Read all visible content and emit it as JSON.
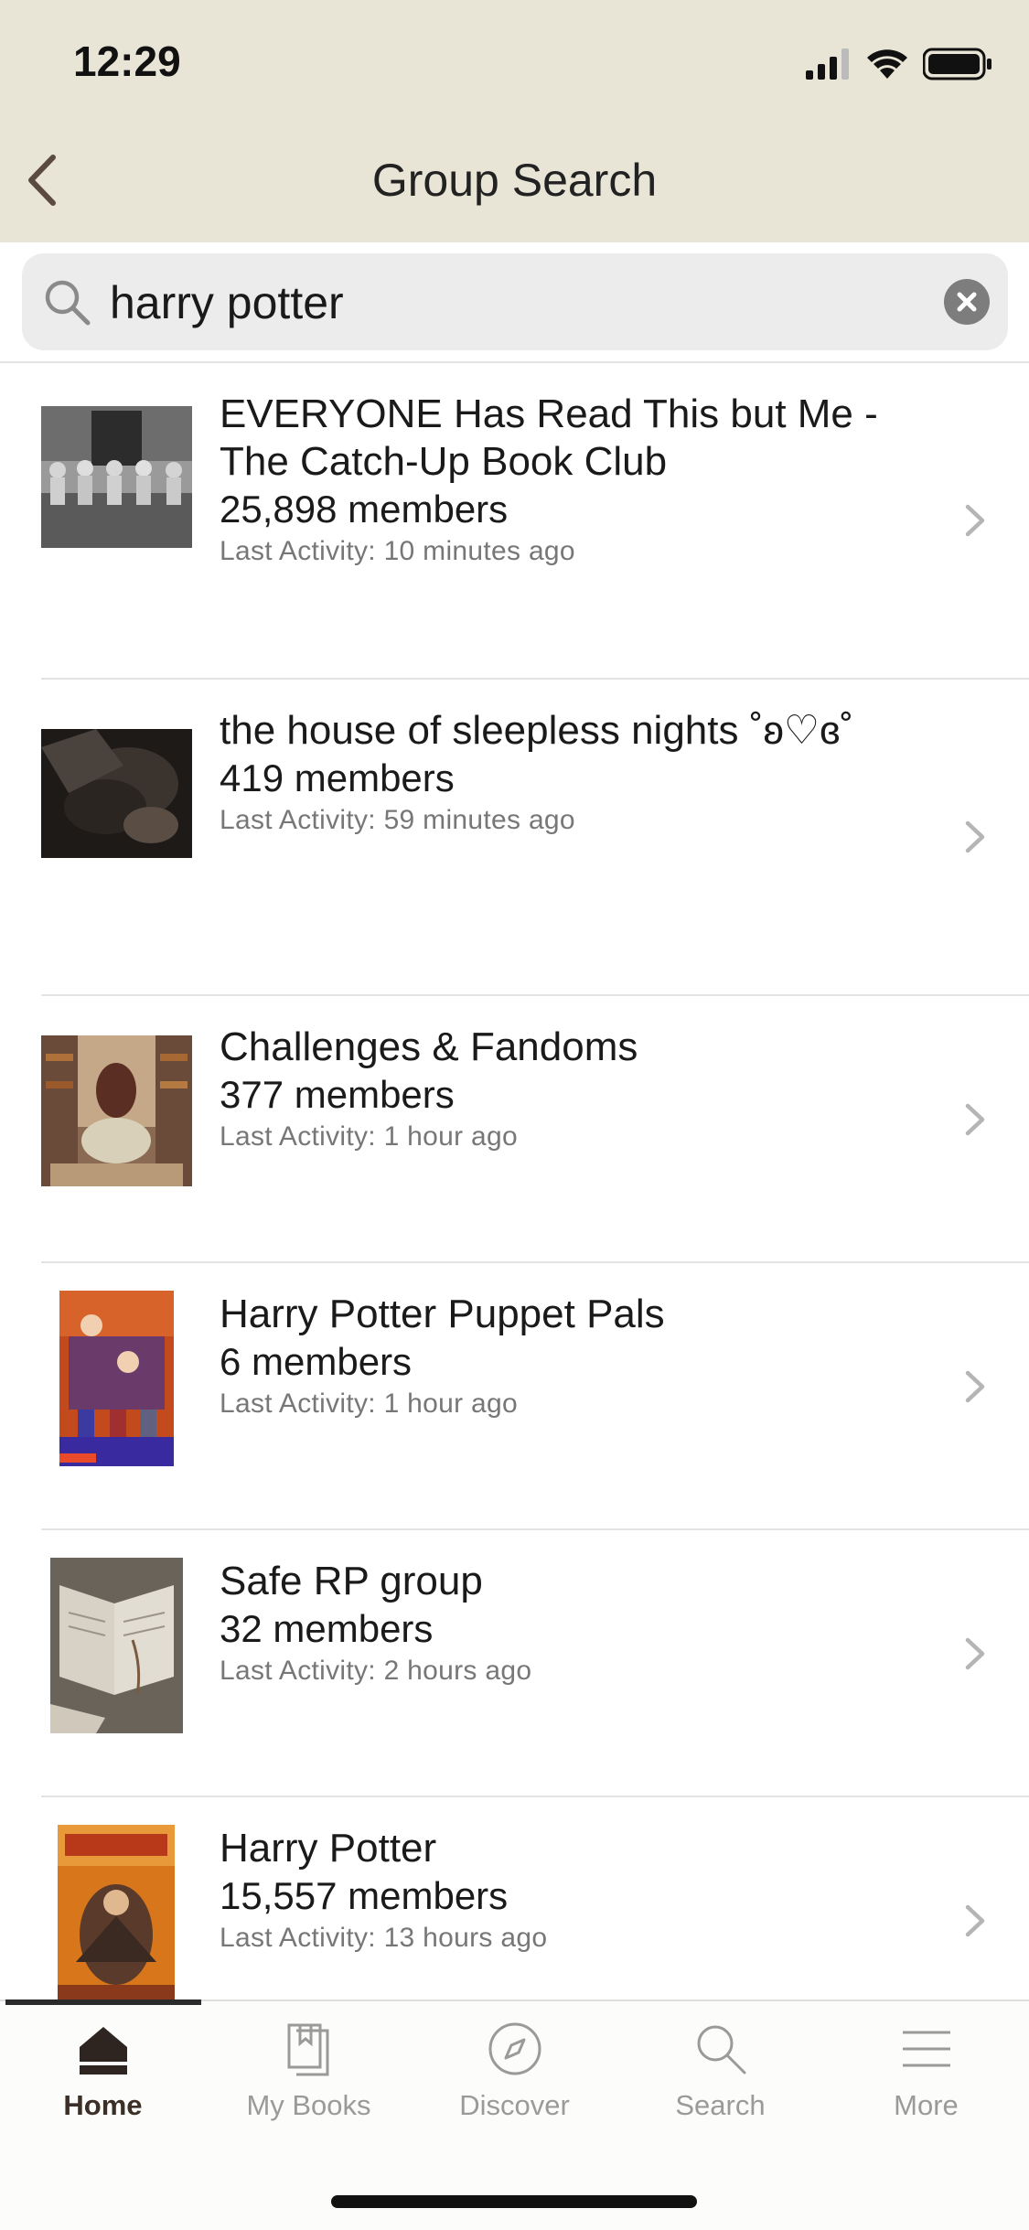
{
  "status_bar": {
    "time": "12:29"
  },
  "nav": {
    "title": "Group Search"
  },
  "search": {
    "value": "harry potter"
  },
  "groups": [
    {
      "title": "EVERYONE Has Read This but Me - The Catch-Up Book Club",
      "members": "25,898 members",
      "activity": "Last Activity: 10 minutes ago"
    },
    {
      "title": "the house of sleepless nights ˚ʚ♡ɞ˚",
      "members": "419 members",
      "activity": "Last Activity: 59 minutes ago"
    },
    {
      "title": "Challenges & Fandoms",
      "members": "377 members",
      "activity": "Last Activity: 1 hour ago"
    },
    {
      "title": "Harry Potter Puppet Pals",
      "members": "6 members",
      "activity": "Last Activity: 1 hour ago"
    },
    {
      "title": "Safe RP group",
      "members": "32 members",
      "activity": "Last Activity: 2 hours ago"
    },
    {
      "title": "Harry Potter",
      "members": "15,557 members",
      "activity": "Last Activity: 13 hours ago"
    }
  ],
  "tabs": [
    {
      "label": "Home",
      "icon": "home-icon",
      "active": true
    },
    {
      "label": "My Books",
      "icon": "books-icon",
      "active": false
    },
    {
      "label": "Discover",
      "icon": "compass-icon",
      "active": false
    },
    {
      "label": "Search",
      "icon": "search-icon",
      "active": false
    },
    {
      "label": "More",
      "icon": "menu-icon",
      "active": false
    }
  ],
  "colors": {
    "header_bg": "#e9e5d6",
    "active_tab": "#3b2f28",
    "inactive_tab": "#9a9a9a"
  }
}
